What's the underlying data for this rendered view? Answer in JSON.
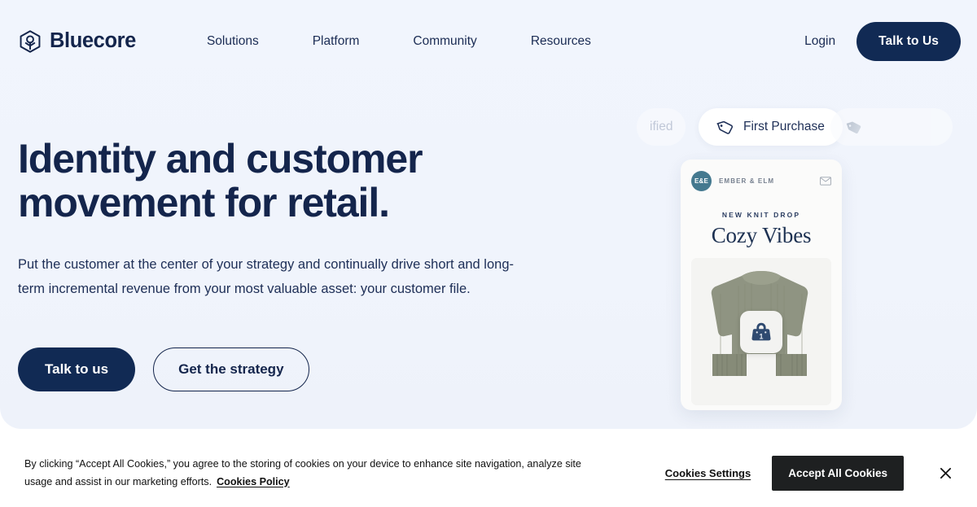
{
  "nav": {
    "brand_name": "Bluecore",
    "brand_icon": "cube-hexagon-icon",
    "links": [
      {
        "label": "Solutions"
      },
      {
        "label": "Platform"
      },
      {
        "label": "Community"
      },
      {
        "label": "Resources"
      }
    ],
    "login_label": "Login",
    "cta_label": "Talk to Us"
  },
  "hero": {
    "title_line1": "Identity and customer",
    "title_line2": "movement for retail.",
    "subtitle": "Put the customer at the center of your strategy and continually drive short and long-term incremental revenue from your most valuable asset: your customer file.",
    "primary_cta": "Talk to us",
    "secondary_cta": "Get the strategy"
  },
  "pills": {
    "previous": {
      "label": "ified",
      "icon": "tag-icon"
    },
    "active": {
      "label": "First Purchase",
      "icon": "tag-outline-icon"
    },
    "next": {
      "label": "",
      "icon": "tag-filled-icon"
    }
  },
  "email_card": {
    "avatar_initials": "E&E",
    "brand": "EMBER & ELM",
    "mail_icon": "envelope-icon",
    "eyebrow": "NEW KNIT DROP",
    "headline": "Cozy Vibes",
    "product_alt": "knit-sweater",
    "badge_icon": "shopping-bag-icon",
    "badge_count": "1"
  },
  "cookie_banner": {
    "message": "By clicking “Accept All Cookies,” you agree to the storing of cookies on your device to enhance site navigation, analyze site usage and assist in our marketing efforts.",
    "policy_link": "Cookies Policy",
    "settings_label": "Cookies Settings",
    "accept_label": "Accept All Cookies",
    "close_icon": "close-icon"
  },
  "colors": {
    "hero_background": "#f0f4fc",
    "navy": "#14254c",
    "navy_button": "#112a54",
    "banner_button": "#1e2021",
    "avatar_teal": "#44798f",
    "sweater_sage": "#8c9180"
  }
}
